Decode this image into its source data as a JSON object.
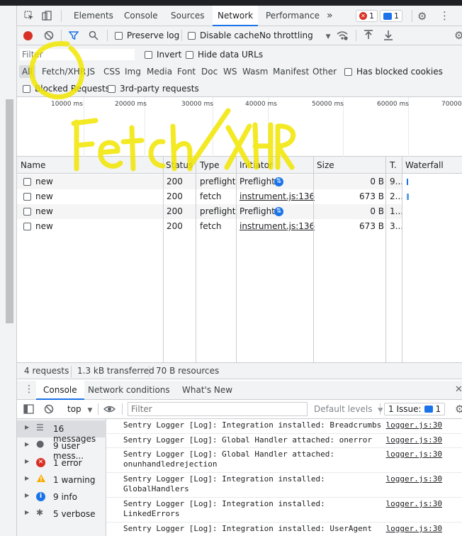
{
  "tabs": {
    "items": [
      "Elements",
      "Console",
      "Sources",
      "Network",
      "Performance"
    ],
    "more": "»",
    "errors_badge": "1",
    "messages_badge": "1"
  },
  "toolbar": {
    "preserve_log": "Preserve log",
    "disable_cache": "Disable cache",
    "throttling": "No throttling"
  },
  "filter": {
    "placeholder": "Filter",
    "invert": "Invert",
    "hide_data_urls": "Hide data URLs",
    "types": [
      "All",
      "Fetch/XHR",
      "JS",
      "CSS",
      "Img",
      "Media",
      "Font",
      "Doc",
      "WS",
      "Wasm",
      "Manifest",
      "Other"
    ],
    "has_blocked_cookies": "Has blocked cookies",
    "blocked_requests": "Blocked Requests",
    "third_party": "3rd-party requests"
  },
  "overview": {
    "ticks": [
      "10000 ms",
      "20000 ms",
      "30000 ms",
      "40000 ms",
      "50000 ms",
      "60000 ms",
      "70000"
    ]
  },
  "annotation": {
    "text": "Fetch / XHR",
    "color": "#f2e600"
  },
  "table": {
    "headers": {
      "name": "Name",
      "status": "Status",
      "type": "Type",
      "initiator": "Initiator",
      "size": "Size",
      "time": "T.",
      "waterfall": "Waterfall"
    },
    "rows": [
      {
        "name": "new",
        "status": "200",
        "type": "preflight",
        "initiator": "Preflight",
        "size": "0 B",
        "time": "9..."
      },
      {
        "name": "new",
        "status": "200",
        "type": "fetch",
        "initiator": "instrument.js:136",
        "size": "673 B",
        "time": "2..."
      },
      {
        "name": "new",
        "status": "200",
        "type": "preflight",
        "initiator": "Preflight",
        "size": "0 B",
        "time": "1..."
      },
      {
        "name": "new",
        "status": "200",
        "type": "fetch",
        "initiator": "instrument.js:136",
        "size": "673 B",
        "time": "3..."
      }
    ]
  },
  "status": {
    "requests": "4 requests",
    "transferred": "1.3 kB transferred",
    "resources": "70 B resources"
  },
  "drawer": {
    "tabs": [
      "Console",
      "Network conditions",
      "What's New"
    ]
  },
  "console_toolbar": {
    "context": "top",
    "filter_placeholder": "Filter",
    "levels": "Default levels",
    "issues": "1 Issue:",
    "issues_count": "1"
  },
  "console_sidebar": [
    {
      "label": "16 messages",
      "icon": "list-icon"
    },
    {
      "label": "9 user mess...",
      "icon": "user-icon"
    },
    {
      "label": "1 error",
      "icon": "error-icon"
    },
    {
      "label": "1 warning",
      "icon": "warning-icon"
    },
    {
      "label": "9 info",
      "icon": "info-icon"
    },
    {
      "label": "5 verbose",
      "icon": "bug-icon"
    }
  ],
  "console_messages": [
    {
      "text": "Sentry Logger [Log]: Integration installed: Breadcrumbs",
      "source": "logger.js:30"
    },
    {
      "text": "Sentry Logger [Log]: Global Handler attached: onerror",
      "source": "logger.js:30"
    },
    {
      "text": "Sentry Logger [Log]: Global Handler attached:\nonunhandledrejection",
      "source": "logger.js:30"
    },
    {
      "text": "Sentry Logger [Log]: Integration installed:\nGlobalHandlers",
      "source": "logger.js:30"
    },
    {
      "text": "Sentry Logger [Log]: Integration installed:\nLinkedErrors",
      "source": "logger.js:30"
    },
    {
      "text": "Sentry Logger [Log]: Integration installed: UserAgent",
      "source": "logger.js:30"
    }
  ]
}
